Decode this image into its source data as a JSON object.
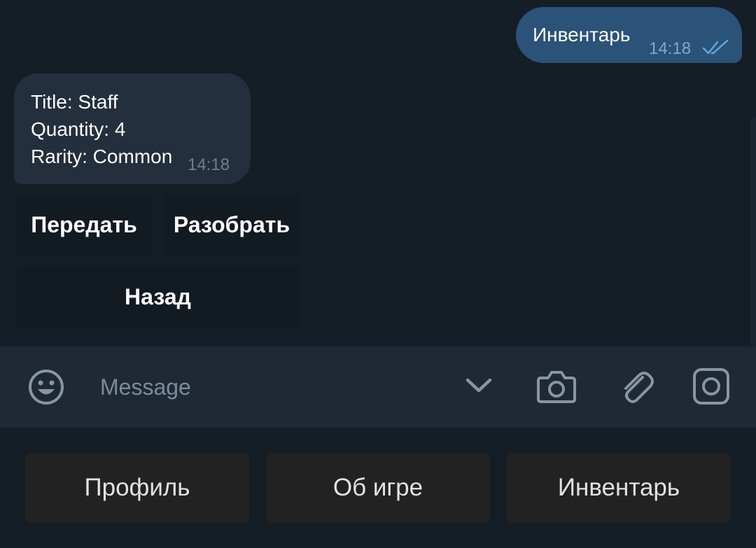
{
  "messages": {
    "outgoing": {
      "text": "Инвентарь",
      "time": "14:18",
      "status_icon": "double-check-icon"
    },
    "incoming": {
      "lines": [
        "Title: Staff",
        "Quantity: 4",
        "Rarity: Common"
      ],
      "time": "14:18"
    }
  },
  "inline_keyboard": {
    "buttons": [
      "Передать",
      "Разобрать",
      "Назад"
    ]
  },
  "composer": {
    "placeholder": "Message",
    "icons": [
      "emoji-icon",
      "chevron-down-icon",
      "camera-icon",
      "paperclip-icon",
      "instagram-icon"
    ]
  },
  "reply_keyboard": {
    "buttons": [
      "Профиль",
      "Об игре",
      "Инвентарь"
    ]
  },
  "colors": {
    "background": "#151d27",
    "outgoing_bubble": "#2b5278",
    "incoming_bubble": "#242f3d",
    "composer": "#1f2936",
    "inline_button": "#121a22",
    "reply_button": "#222222",
    "read_ticks": "#63a7e3"
  }
}
